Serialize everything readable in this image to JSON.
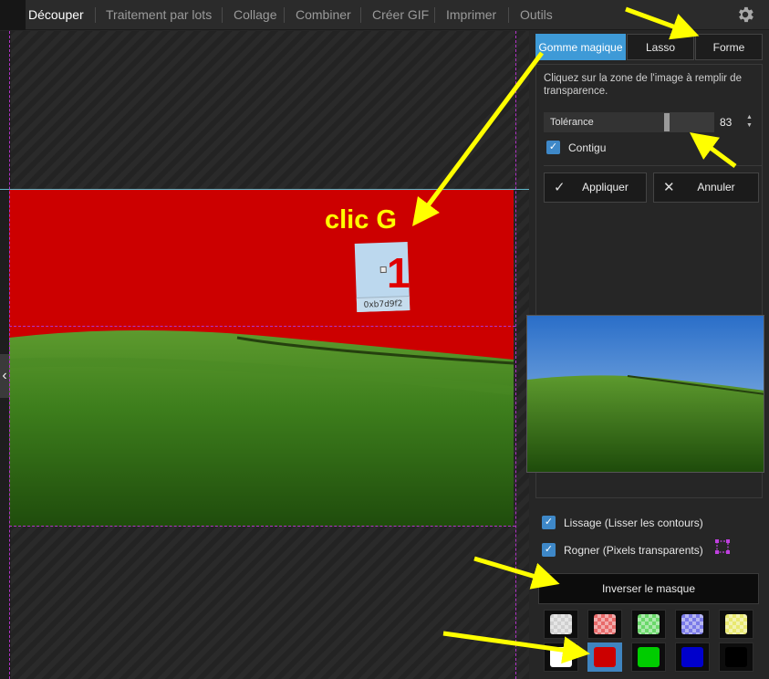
{
  "nav": {
    "tabs": [
      {
        "label": "Découper",
        "active": true
      },
      {
        "label": "Traitement par lots"
      },
      {
        "label": "Collage"
      },
      {
        "label": "Combiner"
      },
      {
        "label": "Créer GIF"
      },
      {
        "label": "Imprimer"
      },
      {
        "label": "Outils"
      }
    ],
    "settings_icon": "gear-icon"
  },
  "canvas": {
    "annotation_text": "clic G",
    "marker_number": "1",
    "color_hex": "0xb7d9f2",
    "collapse_icon": "chevron-left-icon"
  },
  "panel": {
    "modes": [
      "Gomme magique",
      "Lasso",
      "Forme"
    ],
    "active_mode": "Gomme magique",
    "hint": "Cliquez sur la zone de l'image à remplir de transparence.",
    "tolerance": {
      "label": "Tolérance",
      "value": "83",
      "max": 100
    },
    "contigu": {
      "label": "Contigu",
      "checked": true
    },
    "apply_label": "Appliquer",
    "cancel_label": "Annuler",
    "lissage": {
      "label": "Lissage (Lisser les contours)",
      "checked": true
    },
    "rogner": {
      "label": "Rogner (Pixels transparents)",
      "checked": true
    },
    "invert_label": "Inverser le masque",
    "swatches": [
      {
        "name": "transparent-gray",
        "color": "#cfcfcf",
        "checker": true
      },
      {
        "name": "transparent-red",
        "color": "#e86a6a",
        "checker": true
      },
      {
        "name": "transparent-green",
        "color": "#6ad86a",
        "checker": true
      },
      {
        "name": "transparent-blue",
        "color": "#7a7ae8",
        "checker": true
      },
      {
        "name": "transparent-yellow",
        "color": "#e8e870",
        "checker": true
      },
      {
        "name": "white",
        "color": "#ffffff"
      },
      {
        "name": "red",
        "color": "#cc0000",
        "selected": true
      },
      {
        "name": "green",
        "color": "#00cc00"
      },
      {
        "name": "blue",
        "color": "#0000cc"
      },
      {
        "name": "black",
        "color": "#000000"
      }
    ]
  },
  "colors": {
    "accent": "#3e9ad7",
    "mask": "#cc0000",
    "annotation": "#ffff00"
  }
}
